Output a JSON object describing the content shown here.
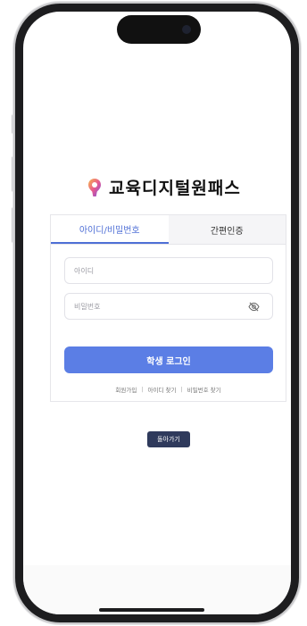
{
  "app": {
    "logo_text": "교육디지털원패스",
    "brand_color": "#5b7ee5"
  },
  "login": {
    "tabs": [
      {
        "label": "아이디/비밀번호",
        "active": true
      },
      {
        "label": "간편인증",
        "active": false
      }
    ],
    "id_placeholder": "아이디",
    "password_placeholder": "비밀번호",
    "login_button": "학생 로그인",
    "links": [
      "회원가입",
      "아이디 찾기",
      "비밀번호 찾기"
    ],
    "separator": "|"
  },
  "back_button": "돌아가기"
}
